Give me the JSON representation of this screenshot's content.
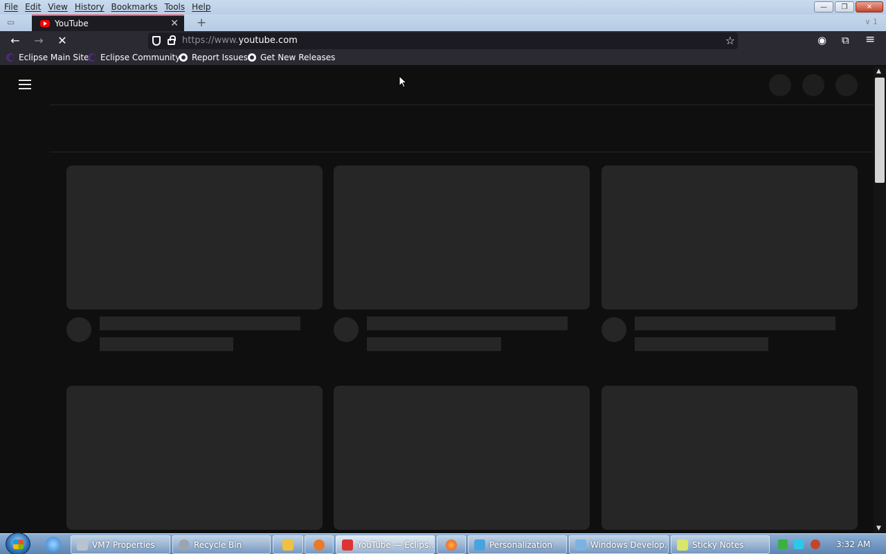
{
  "menu": {
    "items": [
      "File",
      "Edit",
      "View",
      "History",
      "Bookmarks",
      "Tools",
      "Help"
    ]
  },
  "window_controls": {
    "minimize": "—",
    "restore": "❐",
    "close": "✕"
  },
  "tabs": {
    "active": {
      "title": "YouTube",
      "close": "✕"
    },
    "new_tab": "+",
    "list_count": "∨ 1"
  },
  "navbar": {
    "back": "←",
    "forward": "→",
    "stop": "✕",
    "url_scheme": "https://www.",
    "url_host": "youtube.com",
    "bookmark_star": "☆",
    "account": "◉",
    "extensions": "⧉",
    "menu": "≡"
  },
  "bookmarks": [
    {
      "label": "Eclipse Main Site",
      "icon": "eclipse-icon"
    },
    {
      "label": "Eclipse Community",
      "icon": "eclipse-icon"
    },
    {
      "label": "Report Issues",
      "icon": "github-icon"
    },
    {
      "label": "Get New Releases",
      "icon": "github-icon"
    }
  ],
  "page": {
    "state": "loading-skeleton",
    "header_icons": [
      "skeleton-circle",
      "skeleton-circle",
      "skeleton-circle"
    ],
    "video_cards": 6
  },
  "scrollbar": {
    "up": "▲",
    "down": "▼"
  },
  "taskbar": {
    "items": [
      {
        "label": "VM7 Properties",
        "color": "#b9c3cf"
      },
      {
        "label": "Recycle Bin",
        "color": "#9aa5b0"
      },
      {
        "label": "YouTube — Eclips...",
        "color": "#d33",
        "active": true
      },
      {
        "label": "Personalization",
        "color": "#4aa3df"
      },
      {
        "label": "Windows Develop...",
        "color": "#7db2e0"
      },
      {
        "label": "Sticky Notes",
        "color": "#d8e66a"
      }
    ],
    "clock": "3:32 AM"
  },
  "colors": {
    "page_bg": "#0f0f0f",
    "skeleton": "#262626",
    "browser_chrome": "#2b2a33",
    "tab_accent": "#ff4f5e"
  }
}
